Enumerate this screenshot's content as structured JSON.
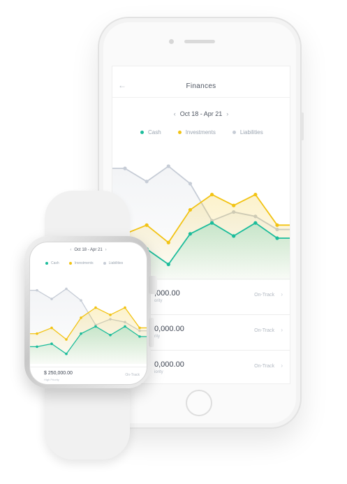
{
  "app": {
    "title": "Finances",
    "date_range": "Oct 18 - Apr 21"
  },
  "icons": {
    "back": "back-arrow-icon",
    "prev": "chevron-left-icon",
    "next": "chevron-right-icon",
    "row_arrow": "chevron-right-icon"
  },
  "legend": [
    {
      "label": "Cash",
      "color": "#1bbc9b"
    },
    {
      "label": "Investments",
      "color": "#f2c313"
    },
    {
      "label": "Liabilities",
      "color": "#c6ccd6"
    }
  ],
  "accounts": [
    {
      "amount": ",000.00",
      "sub": "ority",
      "status": "On-Track"
    },
    {
      "amount": "0,000.00",
      "sub": "rity",
      "status": "On-Track"
    },
    {
      "amount": "0,000.00",
      "sub": "iority",
      "status": "On-Track"
    }
  ],
  "watch": {
    "date_range": "Oct 18 - Apr 21",
    "amount": "$ 250,000.00",
    "sub": "High Priority",
    "status": "On-Track"
  },
  "chart_data": {
    "type": "line",
    "x": [
      1,
      2,
      3,
      4,
      5,
      6,
      7,
      8
    ],
    "series": [
      {
        "name": "Liabilities",
        "values": [
          82,
          70,
          84,
          68,
          34,
          42,
          38,
          26
        ]
      },
      {
        "name": "Investments",
        "values": [
          22,
          30,
          14,
          44,
          58,
          48,
          58,
          30
        ]
      },
      {
        "name": "Cash",
        "values": [
          4,
          8,
          -6,
          22,
          32,
          20,
          32,
          18
        ]
      }
    ],
    "ylim": [
      -14,
      100
    ],
    "grid": false,
    "legend_position": "top"
  }
}
